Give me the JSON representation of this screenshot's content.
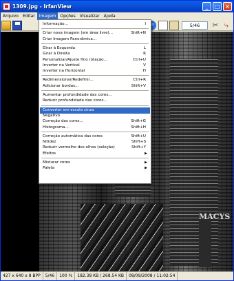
{
  "window": {
    "title": "1309.jpg - IrfanView"
  },
  "titlebar_buttons": {
    "minimize": "_",
    "maximize": "□",
    "close": "×"
  },
  "menubar": [
    "Arquivo",
    "Editar",
    "Imagem",
    "Opções",
    "Visualizar",
    "Ajuda"
  ],
  "toolbar": {
    "page_counter": "5/46",
    "arrow_left": "⇦",
    "arrow_right": "⇨",
    "tools": "✂",
    "exit": "⤷"
  },
  "image_menu": {
    "items": [
      {
        "label": "Informação...",
        "shortcut": "I"
      },
      {
        "sep": true
      },
      {
        "label": "Criar nova imagem (em área livre)...",
        "shortcut": "Shift+N"
      },
      {
        "label": "Criar Imagem Panorâmica...",
        "shortcut": ""
      },
      {
        "sep": true
      },
      {
        "label": "Girar à Esquerda",
        "shortcut": "L"
      },
      {
        "label": "Girar à Direita",
        "shortcut": "R"
      },
      {
        "label": "Personalizar/Ajuste fino rotação...",
        "shortcut": "Ctrl+U"
      },
      {
        "label": "Inverter na Vertical",
        "shortcut": "V"
      },
      {
        "label": "Inverter na Horizontal",
        "shortcut": "H"
      },
      {
        "sep": true
      },
      {
        "label": "Redimensionar/Redefinir...",
        "shortcut": "Ctrl+R"
      },
      {
        "label": "Adicionar bordas...",
        "shortcut": "Shift+V"
      },
      {
        "sep": true
      },
      {
        "label": "Aumentar profundidade das cores...",
        "shortcut": ""
      },
      {
        "label": "Reduzir profundidade das cores...",
        "shortcut": ""
      },
      {
        "sep": true
      },
      {
        "label": "Converter em escala cinza",
        "shortcut": "",
        "highlight": true
      },
      {
        "label": "Negativo",
        "shortcut": ""
      },
      {
        "label": "Correção das cores...",
        "shortcut": "Shift+G"
      },
      {
        "label": "Histograma...",
        "shortcut": "Shift+H"
      },
      {
        "sep": true
      },
      {
        "label": "Correção automática das cores",
        "shortcut": "Shift+U"
      },
      {
        "label": "Nitidez",
        "shortcut": "Shift+S"
      },
      {
        "label": "Reduzir vermelho dos olhos (seleção)",
        "shortcut": "Shift+Y"
      },
      {
        "label": "Efeitos",
        "shortcut": "",
        "submenu": true
      },
      {
        "sep": true
      },
      {
        "label": "Misturar cores",
        "shortcut": "",
        "submenu": true
      },
      {
        "label": "Paleta",
        "shortcut": "",
        "submenu": true
      }
    ]
  },
  "photo_sign": "MACYS",
  "statusbar": {
    "dimensions": "427 x 640 x 8 BPP",
    "index": "5/46",
    "zoom": "100 %",
    "size": "182.38 KB / 268.54 KB",
    "datetime": "08/09/2008 / 11:02:54"
  },
  "colors": {
    "titlebar": "#0a53d8",
    "highlight": "#316ac5",
    "chrome": "#ece9d8"
  }
}
